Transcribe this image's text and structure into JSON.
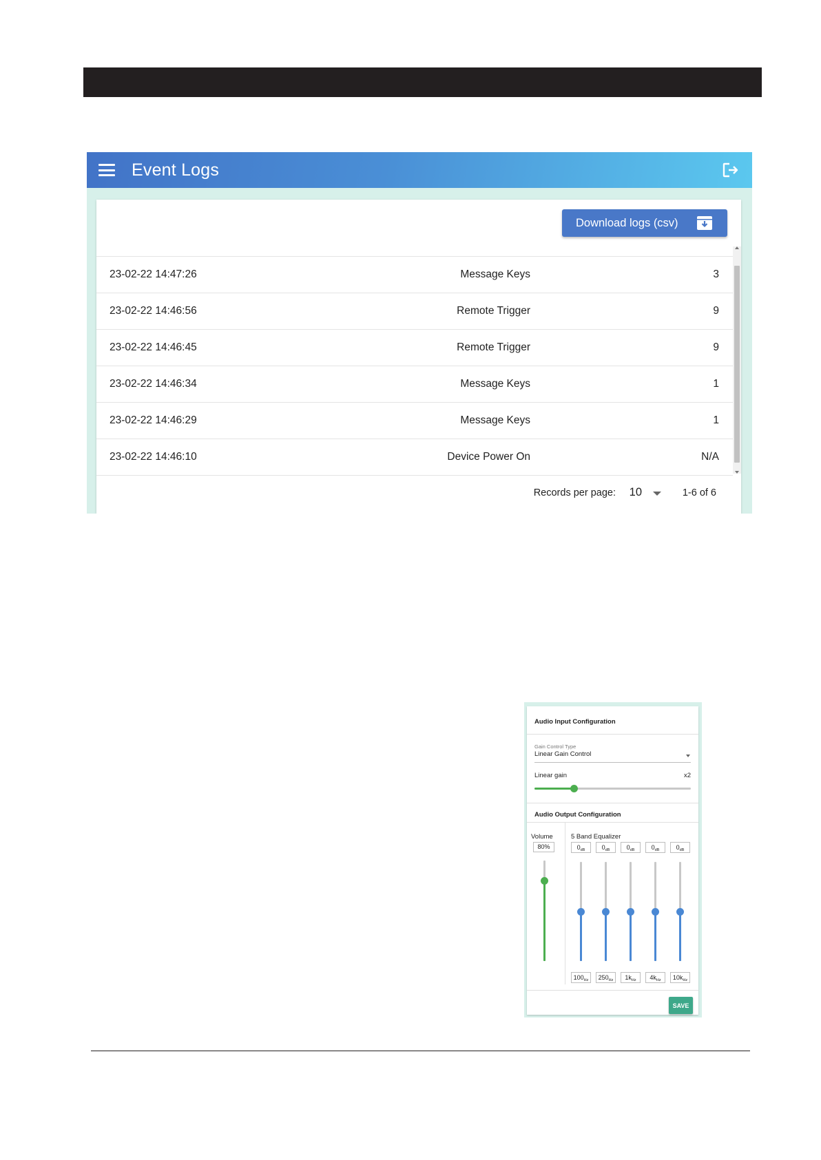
{
  "event_logs": {
    "header": {
      "title": "Event Logs",
      "menu_icon": "menu-icon",
      "logout_icon": "logout-icon"
    },
    "download_button": {
      "label": "Download logs (csv)",
      "icon": "download-archive-icon"
    },
    "rows": [
      {
        "time": "23-02-22 14:47:26",
        "event": "Message Keys",
        "value": "3"
      },
      {
        "time": "23-02-22 14:46:56",
        "event": "Remote Trigger",
        "value": "9"
      },
      {
        "time": "23-02-22 14:46:45",
        "event": "Remote Trigger",
        "value": "9"
      },
      {
        "time": "23-02-22 14:46:34",
        "event": "Message Keys",
        "value": "1"
      },
      {
        "time": "23-02-22 14:46:29",
        "event": "Message Keys",
        "value": "1"
      },
      {
        "time": "23-02-22 14:46:10",
        "event": "Device Power On",
        "value": "N/A"
      }
    ],
    "pagination": {
      "records_per_page_label": "Records per page:",
      "records_per_page": "10",
      "range": "1-6 of 6"
    },
    "colors": {
      "header_start": "#4273c7",
      "header_end": "#5bc8ef",
      "button": "#4978c8"
    }
  },
  "audio": {
    "input_title": "Audio Input Configuration",
    "gain_control_type_label": "Gain Control Type",
    "gain_control_type_value": "Linear Gain Control",
    "linear_gain_label": "Linear gain",
    "linear_gain_value": "x2",
    "linear_gain_fraction": 0.25,
    "output_title": "Audio Output Configuration",
    "volume_label": "Volume",
    "volume_value": "80%",
    "volume_fraction": 0.8,
    "equalizer_title": "5 Band Equalizer",
    "bands": [
      {
        "gain": "0",
        "gain_unit": "dB",
        "freq": "100",
        "freq_unit": "Hz",
        "fraction": 0.5
      },
      {
        "gain": "0",
        "gain_unit": "dB",
        "freq": "250",
        "freq_unit": "Hz",
        "fraction": 0.5
      },
      {
        "gain": "0",
        "gain_unit": "dB",
        "freq": "1k",
        "freq_unit": "Hz",
        "fraction": 0.5
      },
      {
        "gain": "0",
        "gain_unit": "dB",
        "freq": "4k",
        "freq_unit": "Hz",
        "fraction": 0.5
      },
      {
        "gain": "0",
        "gain_unit": "dB",
        "freq": "10k",
        "freq_unit": "Hz",
        "fraction": 0.5
      }
    ],
    "save_label": "SAVE",
    "colors": {
      "gain_slider": "#4cae4f",
      "volume_slider": "#4cae4f",
      "eq_slider": "#4a88d4",
      "save": "#3ea88a"
    }
  }
}
